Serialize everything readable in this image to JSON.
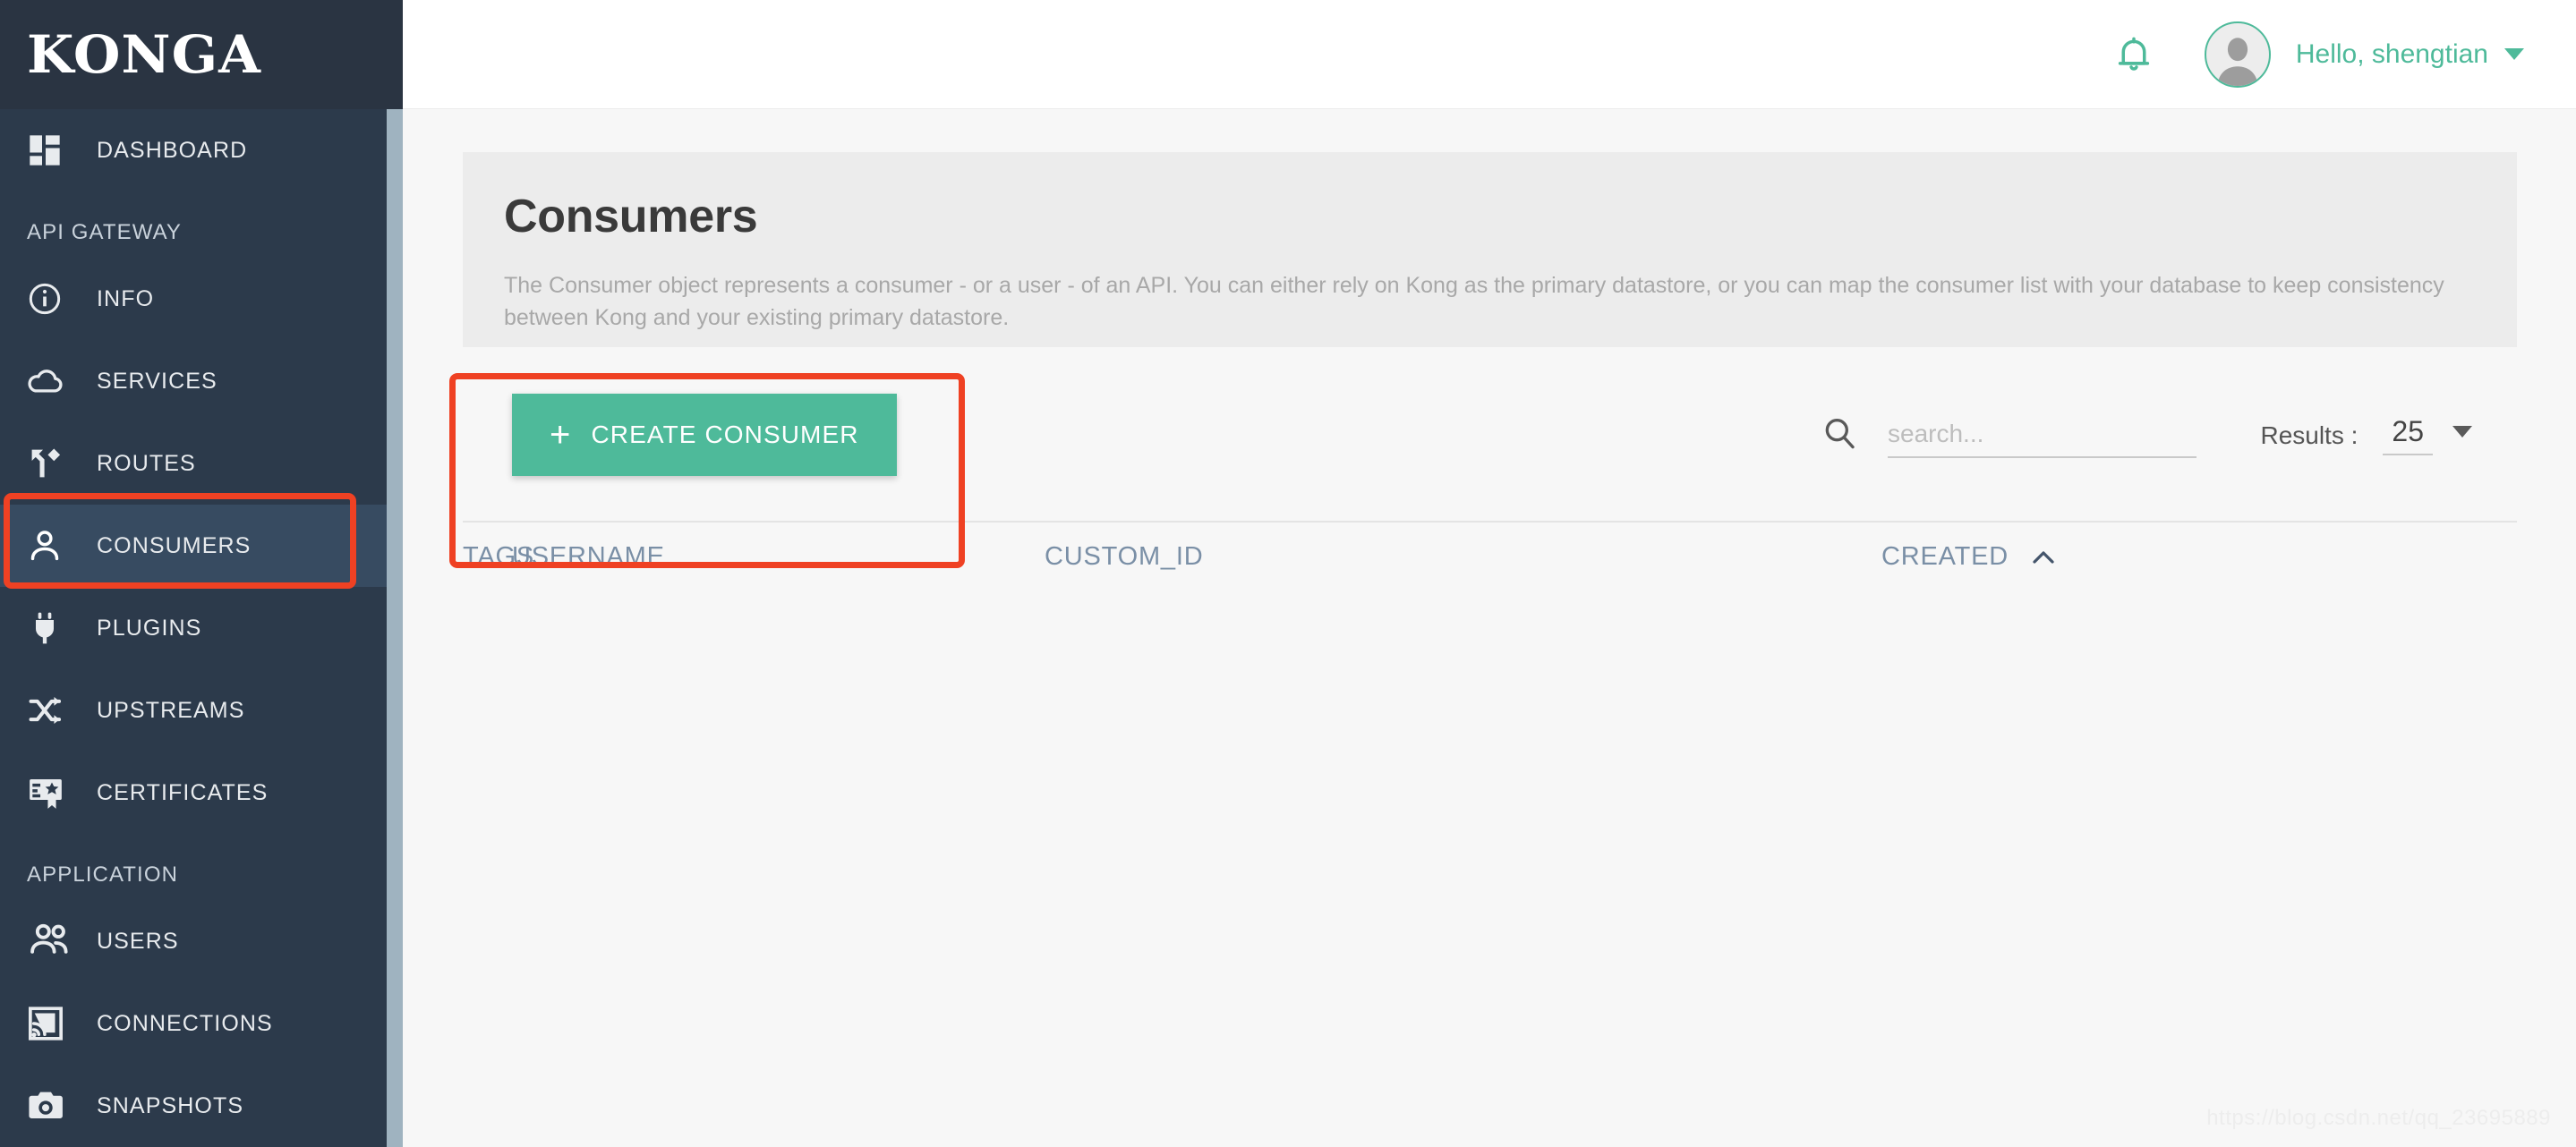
{
  "brand": {
    "logo": "KONGA"
  },
  "sidebar": {
    "groups": [
      {
        "label": null,
        "items": [
          {
            "label": "DASHBOARD",
            "icon": "dashboard-grid-icon",
            "active": false
          }
        ]
      },
      {
        "label": "API GATEWAY",
        "items": [
          {
            "label": "INFO",
            "icon": "info-circle-icon",
            "active": false
          },
          {
            "label": "SERVICES",
            "icon": "cloud-icon",
            "active": false
          },
          {
            "label": "ROUTES",
            "icon": "routes-fork-icon",
            "active": false
          },
          {
            "label": "CONSUMERS",
            "icon": "person-icon",
            "active": true
          },
          {
            "label": "PLUGINS",
            "icon": "plug-icon",
            "active": false
          },
          {
            "label": "UPSTREAMS",
            "icon": "shuffle-arrows-icon",
            "active": false
          },
          {
            "label": "CERTIFICATES",
            "icon": "certificate-badge-icon",
            "active": false
          }
        ]
      },
      {
        "label": "APPLICATION",
        "items": [
          {
            "label": "USERS",
            "icon": "people-icon",
            "active": false
          },
          {
            "label": "CONNECTIONS",
            "icon": "cast-connection-icon",
            "active": false
          },
          {
            "label": "SNAPSHOTS",
            "icon": "camera-icon",
            "active": false
          }
        ]
      }
    ]
  },
  "topbar": {
    "bell_icon": "bell-icon",
    "avatar_icon": "avatar-placeholder-icon",
    "greeting": "Hello, shengtian",
    "caret_icon": "chevron-down-icon"
  },
  "page": {
    "title": "Consumers",
    "description": "The Consumer object represents a consumer - or a user - of an API. You can either rely on Kong as the primary datastore, or you can map the consumer list with your database to keep consistency between Kong and your existing primary datastore."
  },
  "toolbar": {
    "create_label": "CREATE CONSUMER",
    "create_plus": "+",
    "search_icon": "search-icon",
    "search_value": "",
    "search_placeholder": "search...",
    "results_label": "Results :",
    "results_value": "25",
    "results_caret_icon": "chevron-down-icon"
  },
  "table": {
    "columns": [
      {
        "label": "USERNAME",
        "sorted": false,
        "sort_dir": null
      },
      {
        "label": "CUSTOM_ID",
        "sorted": false,
        "sort_dir": null
      },
      {
        "label": "TAGS",
        "sorted": false,
        "sort_dir": null
      },
      {
        "label": "CREATED",
        "sorted": true,
        "sort_dir": "asc"
      }
    ],
    "rows": []
  },
  "annotations": [
    {
      "name": "sidebar-consumers-highlight",
      "color": "#EF4123"
    },
    {
      "name": "create-consumer-highlight",
      "color": "#EF4123"
    }
  ],
  "watermark": "https://blog.csdn.net/qq_23695889",
  "colors": {
    "sidebar_bg": "#2C3A4B",
    "sidebar_logo_bg": "#2A3442",
    "sidebar_active": "#374B61",
    "accent_green": "#4EBA9A",
    "annotation_red": "#EF4123",
    "page_bg": "#F7F7F7",
    "panel_bg": "#ECECEC",
    "table_header": "#7A8FA6"
  }
}
